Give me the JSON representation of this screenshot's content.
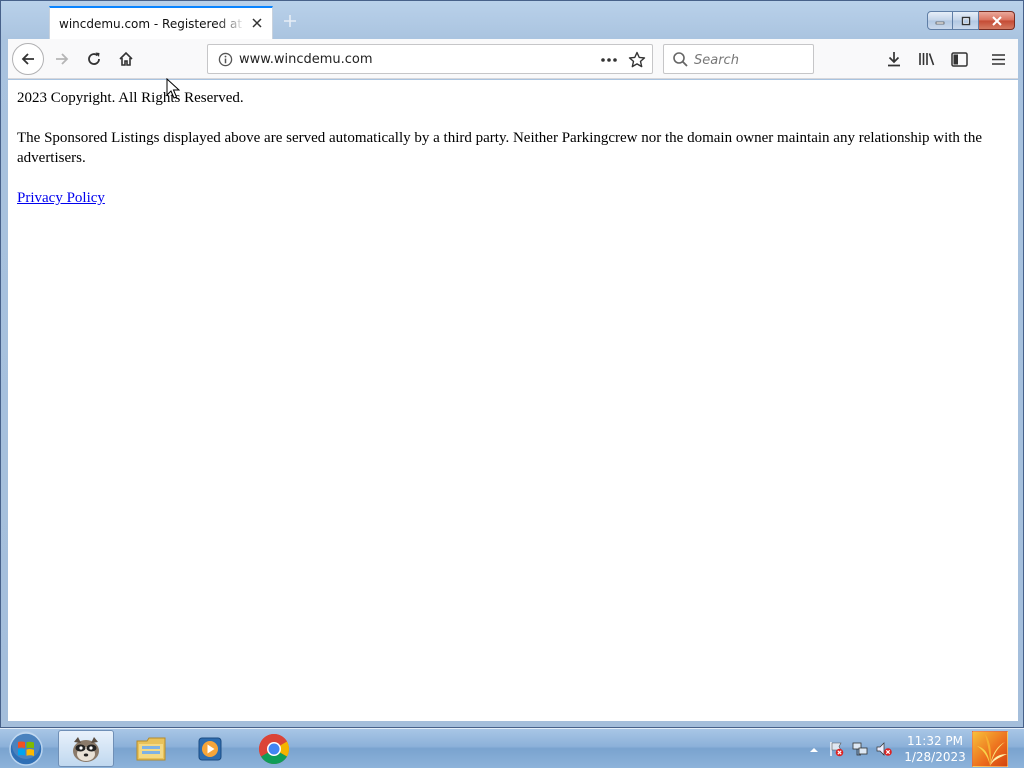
{
  "browser": {
    "tab_title": "wincdemu.com - Registered at Namecheap.com",
    "url": "www.wincdemu.com",
    "search_placeholder": "Search",
    "accent_color": "#0a84ff"
  },
  "page": {
    "copyright": "2023 Copyright. All Rights Reserved.",
    "disclaimer": "The Sponsored Listings displayed above are served automatically by a third party. Neither Parkingcrew nor the domain owner maintain any relationship with the advertisers.",
    "privacy_link": "Privacy Policy",
    "link_color": "#0000ee"
  },
  "taskbar": {
    "clock_time": "11:32 PM",
    "clock_date": "1/28/2023",
    "items": [
      {
        "icon": "wincdemu-raccoon-icon"
      },
      {
        "icon": "file-explorer-icon"
      },
      {
        "icon": "media-player-icon"
      },
      {
        "icon": "chrome-icon"
      }
    ]
  },
  "icons": {
    "back": "back-arrow-icon",
    "forward": "forward-arrow-icon",
    "reload": "reload-icon",
    "home": "home-icon",
    "info": "info-icon",
    "more": "page-actions-icon",
    "bookmark": "star-icon",
    "search": "search-icon",
    "downloads": "download-icon",
    "library": "library-icon",
    "sidebar": "sidebar-icon",
    "menu": "hamburger-menu-icon"
  }
}
